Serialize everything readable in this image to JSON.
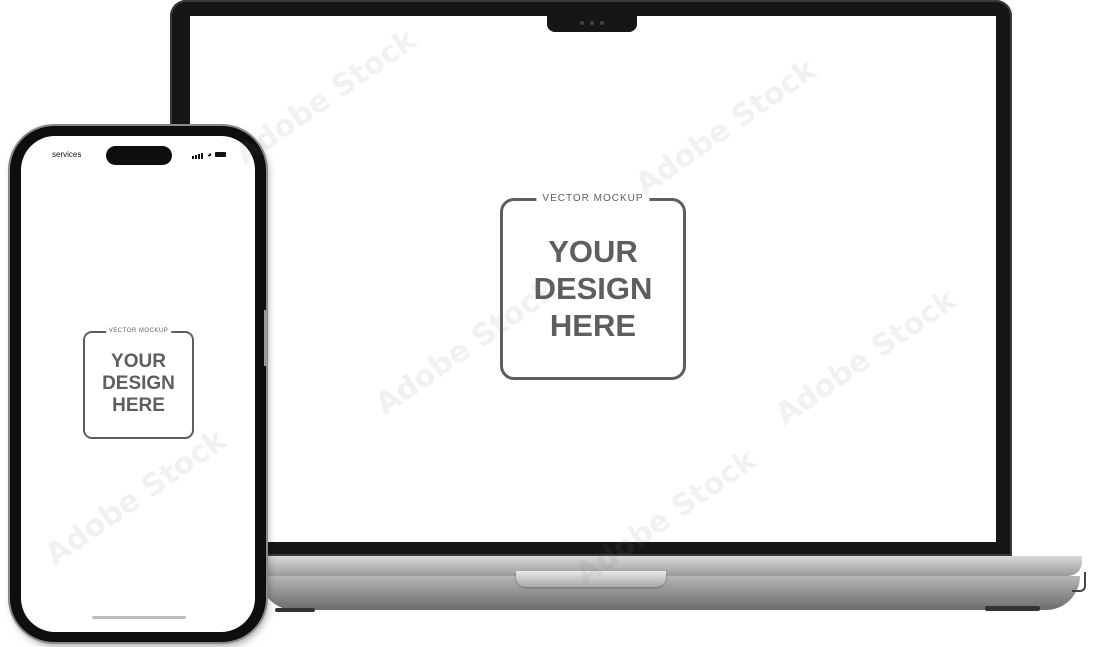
{
  "laptop": {
    "mockup": {
      "label": "VECTOR MOCKUP",
      "line1": "YOUR",
      "line2": "DESIGN",
      "line3": "HERE"
    }
  },
  "phone": {
    "status_bar": {
      "carrier": "services"
    },
    "mockup": {
      "label": "VECTOR MOCKUP",
      "line1": "YOUR",
      "line2": "DESIGN",
      "line3": "HERE"
    }
  },
  "watermark": {
    "text": "Adobe Stock"
  },
  "colors": {
    "device_frame": "#161616",
    "mockup_gray": "#5e5e5e",
    "screen": "#ffffff"
  }
}
